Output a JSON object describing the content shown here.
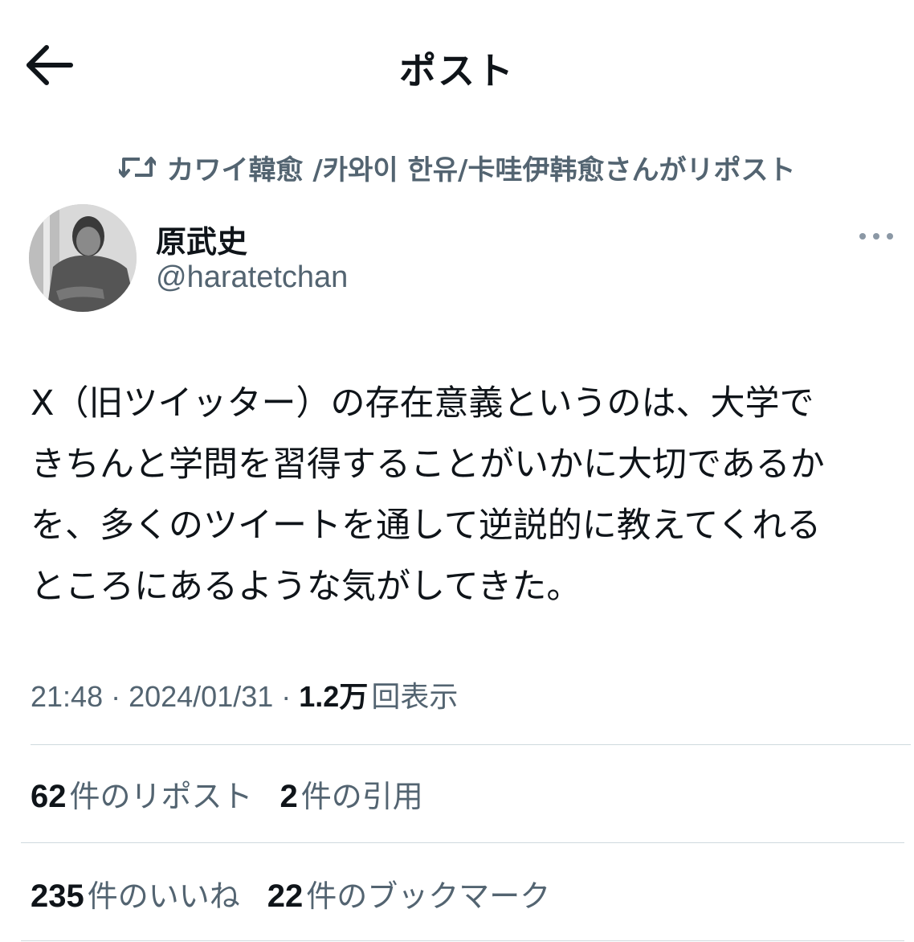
{
  "header": {
    "title": "ポスト",
    "back_icon": "arrow-left-icon"
  },
  "repost": {
    "icon": "retweet-icon",
    "text": "カワイ韓愈 /카와이 한유/卡哇伊韩愈さんがリポスト"
  },
  "author": {
    "display_name": "原武史",
    "handle": "@haratetchan",
    "more_icon": "more-horizontal-icon"
  },
  "post": {
    "text": "X（旧ツイッター）の存在意義というのは、大学で\nきちんと学問を習得することがいかに大切であるか\nを、多くのツイートを通して逆説的に教えてくれる\nところにあるような気がしてきた。"
  },
  "meta": {
    "time": "21:48",
    "date": "2024/01/31",
    "separator": "·",
    "views_count": "1.2万",
    "views_label": "回表示"
  },
  "stats": {
    "reposts": {
      "count": "62",
      "label": "件のリポスト"
    },
    "quotes": {
      "count": "2",
      "label": "件の引用"
    },
    "likes": {
      "count": "235",
      "label": "件のいいね"
    },
    "bookmarks": {
      "count": "22",
      "label": "件のブックマーク"
    }
  },
  "colors": {
    "text_primary": "#0f1419",
    "text_secondary": "#536471",
    "divider": "#cfd9de",
    "background": "#ffffff"
  }
}
